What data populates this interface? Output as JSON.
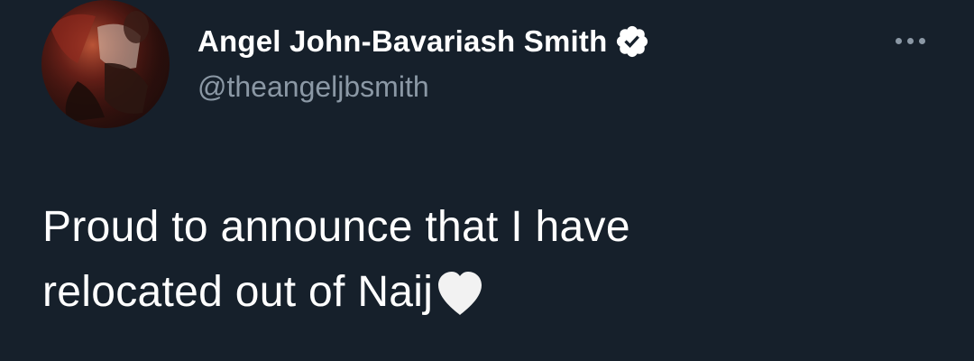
{
  "tweet": {
    "author": {
      "display_name": "Angel John-Bavariash Smith",
      "handle": "@theangeljbsmith",
      "verified": true,
      "avatar_icon": "profile-photo"
    },
    "more_icon": "more-horizontal-icon",
    "text_line_1": "Proud to announce that I have",
    "text_line_2": "relocated out of Naij",
    "emoji": "white-heart-icon"
  },
  "colors": {
    "background": "#16202b",
    "name": "#ffffff",
    "secondary": "#8b98a5",
    "text": "#ffffff",
    "verified_badge": "#ffffff"
  }
}
